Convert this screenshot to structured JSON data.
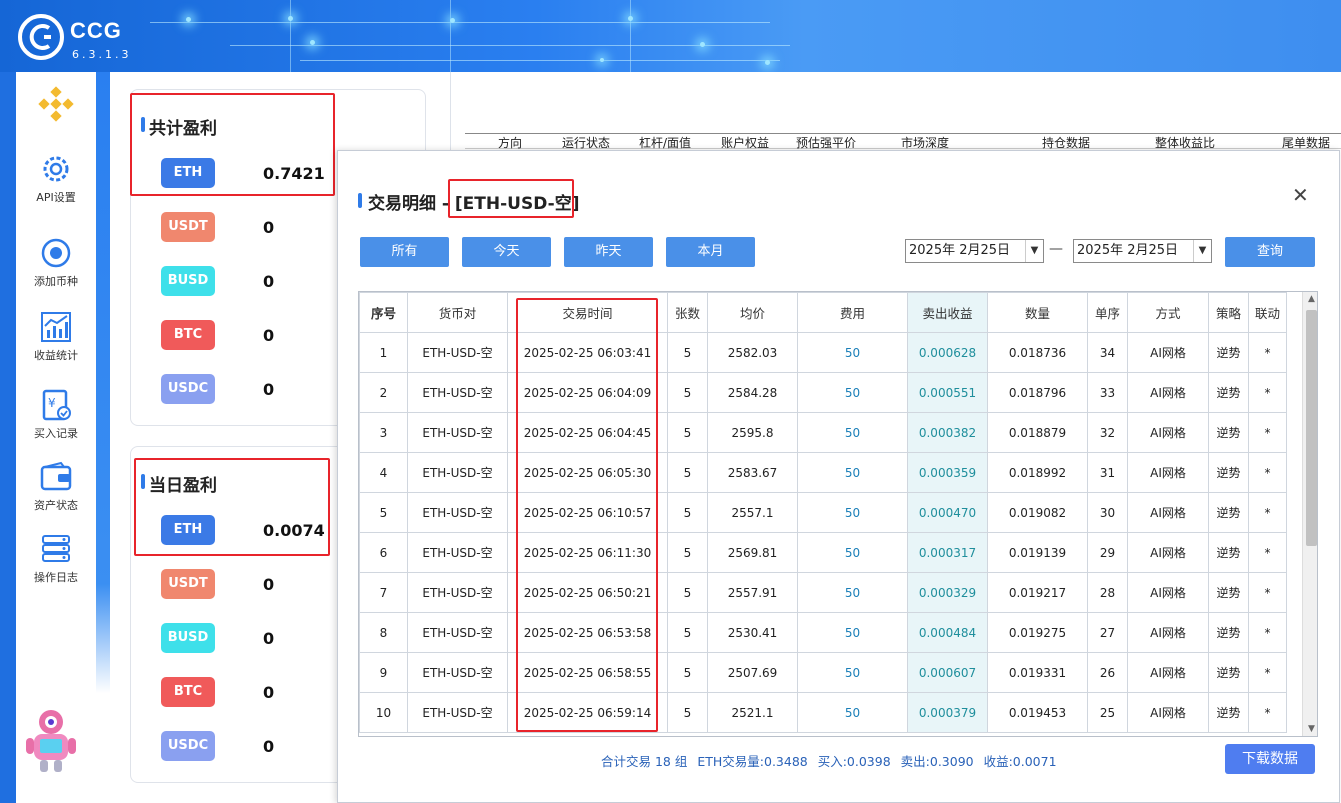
{
  "app": {
    "brand": "CCG",
    "version": "6.3.1.3"
  },
  "sidebar": {
    "items": [
      {
        "label": "API设置",
        "icon": "gear-icon"
      },
      {
        "label": "添加币种",
        "icon": "target-icon"
      },
      {
        "label": "收益统计",
        "icon": "chart-icon"
      },
      {
        "label": "买入记录",
        "icon": "receipt-icon"
      },
      {
        "label": "资产状态",
        "icon": "wallet-icon"
      },
      {
        "label": "操作日志",
        "icon": "server-icon"
      }
    ]
  },
  "total_profit": {
    "title": "共计盈利",
    "coins": [
      {
        "name": "ETH",
        "value": "0.7421",
        "color": "#3b7ae6"
      },
      {
        "name": "USDT",
        "value": "0",
        "color": "#f0876e"
      },
      {
        "name": "BUSD",
        "value": "0",
        "color": "#3ee0ea"
      },
      {
        "name": "BTC",
        "value": "0",
        "color": "#f05a5a"
      },
      {
        "name": "USDC",
        "value": "0",
        "color": "#8aa0f0"
      }
    ]
  },
  "daily_profit": {
    "title": "当日盈利",
    "coins": [
      {
        "name": "ETH",
        "value": "0.0074",
        "color": "#3b7ae6"
      },
      {
        "name": "USDT",
        "value": "0",
        "color": "#f0876e"
      },
      {
        "name": "BUSD",
        "value": "0",
        "color": "#3ee0ea"
      },
      {
        "name": "BTC",
        "value": "0",
        "color": "#f05a5a"
      },
      {
        "name": "USDC",
        "value": "0",
        "color": "#8aa0f0"
      }
    ]
  },
  "bg_table": {
    "headers": [
      "方向",
      "运行状态",
      "杠杆/面值",
      "账户权益",
      "预估强平价",
      "市场深度",
      "持仓数据",
      "整体收益比",
      "尾单数据"
    ]
  },
  "modal": {
    "title_prefix": "交易明细 - ",
    "title_pair": "[ETH-USD-空]",
    "filters": [
      "所有",
      "今天",
      "昨天",
      "本月"
    ],
    "date_from": "2025年  2月25日",
    "date_to": "2025年  2月25日",
    "query_label": "查询",
    "columns": [
      "序号",
      "货币对",
      "交易时间",
      "张数",
      "均价",
      "费用",
      "卖出收益",
      "数量",
      "单序",
      "方式",
      "策略",
      "联动"
    ],
    "rows": [
      [
        "1",
        "ETH-USD-空",
        "2025-02-25 06:03:41",
        "5",
        "2582.03",
        "50",
        "0.000628",
        "0.018736",
        "34",
        "AI网格",
        "逆势",
        "*"
      ],
      [
        "2",
        "ETH-USD-空",
        "2025-02-25 06:04:09",
        "5",
        "2584.28",
        "50",
        "0.000551",
        "0.018796",
        "33",
        "AI网格",
        "逆势",
        "*"
      ],
      [
        "3",
        "ETH-USD-空",
        "2025-02-25 06:04:45",
        "5",
        "2595.8",
        "50",
        "0.000382",
        "0.018879",
        "32",
        "AI网格",
        "逆势",
        "*"
      ],
      [
        "4",
        "ETH-USD-空",
        "2025-02-25 06:05:30",
        "5",
        "2583.67",
        "50",
        "0.000359",
        "0.018992",
        "31",
        "AI网格",
        "逆势",
        "*"
      ],
      [
        "5",
        "ETH-USD-空",
        "2025-02-25 06:10:57",
        "5",
        "2557.1",
        "50",
        "0.000470",
        "0.019082",
        "30",
        "AI网格",
        "逆势",
        "*"
      ],
      [
        "6",
        "ETH-USD-空",
        "2025-02-25 06:11:30",
        "5",
        "2569.81",
        "50",
        "0.000317",
        "0.019139",
        "29",
        "AI网格",
        "逆势",
        "*"
      ],
      [
        "7",
        "ETH-USD-空",
        "2025-02-25 06:50:21",
        "5",
        "2557.91",
        "50",
        "0.000329",
        "0.019217",
        "28",
        "AI网格",
        "逆势",
        "*"
      ],
      [
        "8",
        "ETH-USD-空",
        "2025-02-25 06:53:58",
        "5",
        "2530.41",
        "50",
        "0.000484",
        "0.019275",
        "27",
        "AI网格",
        "逆势",
        "*"
      ],
      [
        "9",
        "ETH-USD-空",
        "2025-02-25 06:58:55",
        "5",
        "2507.69",
        "50",
        "0.000607",
        "0.019331",
        "26",
        "AI网格",
        "逆势",
        "*"
      ],
      [
        "10",
        "ETH-USD-空",
        "2025-02-25 06:59:14",
        "5",
        "2521.1",
        "50",
        "0.000379",
        "0.019453",
        "25",
        "AI网格",
        "逆势",
        "*"
      ]
    ],
    "summary": {
      "count": "合计交易 18 组",
      "eth_volume": "ETH交易量:0.3488",
      "buy": "买入:0.0398",
      "sell": "卖出:0.3090",
      "profit": "收益:0.0071"
    },
    "download_label": "下载数据"
  }
}
